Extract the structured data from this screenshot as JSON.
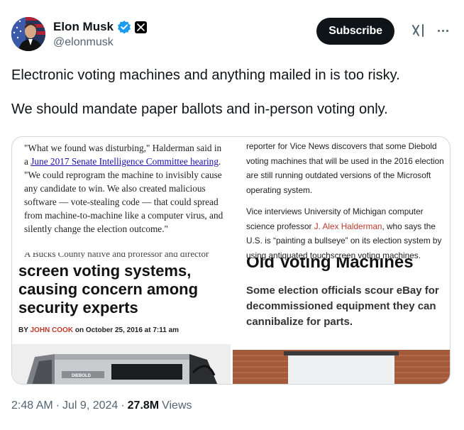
{
  "author": {
    "display_name": "Elon Musk",
    "handle": "@elonmusk",
    "verified_icon": "verified-badge-icon",
    "affiliate_icon": "x-logo-icon"
  },
  "actions": {
    "subscribe_label": "Subscribe",
    "grok_icon": "grok-icon",
    "more_icon": "more-options-icon"
  },
  "tweet": {
    "line1": "Electronic voting machines and anything mailed in is too risky.",
    "line2": "We should mandate paper ballots and in-person voting only."
  },
  "media": {
    "left": {
      "quote_part1": "\"What we found was disturbing,\" Halderman said in a ",
      "quote_link": "June 2017 Senate Intelligence Committee hearing",
      "quote_part2": ". \"We could reprogram the machine to invisibly cause any candidate to win. We also created malicious software — vote-stealing code — that could spread from machine-to-machine like a computer virus, and silently change the election outcome.\"",
      "cut_line": "A Bucks County native and professor and director",
      "headline": "screen voting systems, causing concern among security experts",
      "byline_prefix": "BY",
      "byline_author": "JOHN COOK",
      "byline_date": "on October 25, 2016 at 7:11 am",
      "machine_label": "DIEBOLD"
    },
    "right": {
      "para1": "reporter for Vice News discovers that some Diebold voting machines that will be used in the 2016 election are still running outdated versions of the Microsoft operating system.",
      "para2_a": "Vice interviews University of Michigan computer science professor ",
      "para2_person": "J. Alex Halderman",
      "para2_b": ", who says the U.S. is “painting a bullseye” on its election system by using antiquated touchscreen voting machines.",
      "big_heading": "Old Voting Machines",
      "subheading": "Some election officials scour eBay for decommissioned equipment they can cannibalize for parts."
    }
  },
  "meta": {
    "time": "2:48 AM",
    "sep1": "·",
    "date": "Jul 9, 2024",
    "sep2": "·",
    "views_count": "27.8M",
    "views_label": "Views"
  },
  "colors": {
    "text": "#0f1419",
    "secondary": "#536471",
    "verified": "#1d9bf0",
    "link": "#1a0dab",
    "accent_red": "#c0392b"
  }
}
